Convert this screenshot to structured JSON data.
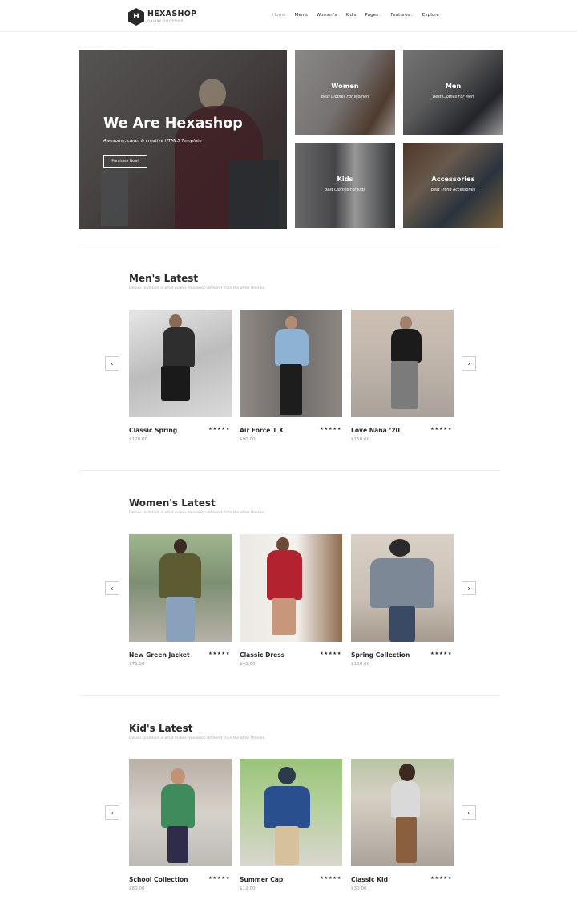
{
  "brand": {
    "name": "HEXASHOP",
    "tagline": "ONLINE SHOPPING",
    "logo_letter": "H"
  },
  "nav": {
    "items": [
      {
        "label": "Home"
      },
      {
        "label": "Men's"
      },
      {
        "label": "Women's"
      },
      {
        "label": "Kid's"
      },
      {
        "label": "Pages"
      },
      {
        "label": "Features"
      },
      {
        "label": "Explore"
      }
    ],
    "dropdown_caret": "⌄"
  },
  "hero": {
    "title": "We Are Hexashop",
    "subtitle": "Awesome, clean & creative HTML5 Template",
    "button": "Purchase Now!"
  },
  "categories": [
    {
      "title": "Women",
      "subtitle": "Best Clothes For Women"
    },
    {
      "title": "Men",
      "subtitle": "Best Clothes For Men"
    },
    {
      "title": "Kids",
      "subtitle": "Best Clothes For Kids"
    },
    {
      "title": "Accessories",
      "subtitle": "Best Trend Accessories"
    }
  ],
  "sections": {
    "mens": {
      "title": "Men's Latest",
      "subtitle": "Details to details is what makes Hexashop different from the other themes.",
      "products": [
        {
          "name": "Classic Spring",
          "price": "$120.00",
          "rating": "★★★★★"
        },
        {
          "name": "Air Force 1 X",
          "price": "$90.00",
          "rating": "★★★★★"
        },
        {
          "name": "Love Nana ‘20",
          "price": "$150.00",
          "rating": "★★★★★"
        }
      ]
    },
    "womens": {
      "title": "Women's Latest",
      "subtitle": "Details to details is what makes Hexashop different from the other themes.",
      "products": [
        {
          "name": "New Green Jacket",
          "price": "$75.00",
          "rating": "★★★★★"
        },
        {
          "name": "Classic Dress",
          "price": "$45.00",
          "rating": "★★★★★"
        },
        {
          "name": "Spring Collection",
          "price": "$130.00",
          "rating": "★★★★★"
        }
      ]
    },
    "kids": {
      "title": "Kid's Latest",
      "subtitle": "Details to details is what makes Hexashop different from the other themes.",
      "products": [
        {
          "name": "School Collection",
          "price": "$80.00",
          "rating": "★★★★★"
        },
        {
          "name": "Summer Cap",
          "price": "$12.00",
          "rating": "★★★★★"
        },
        {
          "name": "Classic Kid",
          "price": "$30.00",
          "rating": "★★★★★"
        }
      ]
    }
  },
  "carousel": {
    "prev_glyph": "‹",
    "next_glyph": "›"
  },
  "icons": {
    "logo": "hexagon-logo-icon",
    "prev": "chevron-left-icon",
    "next": "chevron-right-icon",
    "rating": "star-icon"
  },
  "colors": {
    "text": "#2a2a2a",
    "muted": "#999999",
    "divider": "#eeeeee",
    "background": "#ffffff"
  }
}
